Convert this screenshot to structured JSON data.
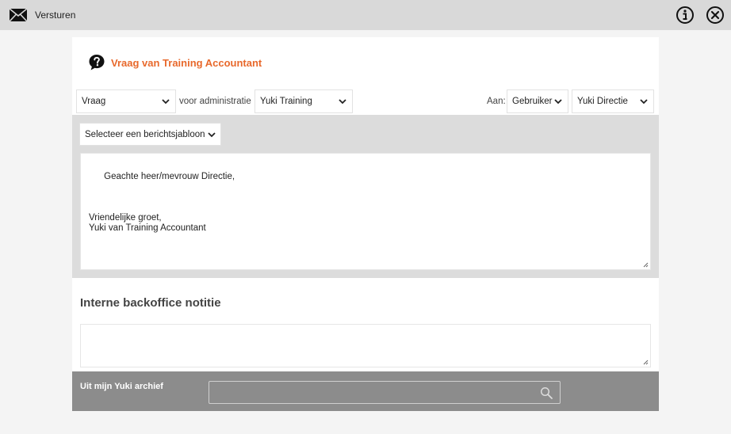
{
  "topbar": {
    "send_label": "Versturen",
    "icons": [
      "mail-icon",
      "info-icon",
      "close-icon"
    ]
  },
  "dialog": {
    "title": "Vraag van Training Accountant",
    "title_color": "#e8692c",
    "type_select": {
      "value": "Vraag"
    },
    "admin_label": "voor administratie",
    "admin_select": {
      "value": "Yuki Training"
    },
    "to_label": "Aan:",
    "recipient_type_select": {
      "value": "Gebruiker"
    },
    "recipient_select": {
      "value": "Yuki Directie"
    },
    "template_select": {
      "value": "Selecteer een berichtsjabloon"
    },
    "message_body": "Geachte heer/mevrouw Directie,\n\n\n\nVriendelijke groet,\nYuki van Training Accountant",
    "internal_note_heading": "Interne backoffice notitie",
    "internal_note_value": "",
    "archive": {
      "label": "Uit mijn Yuki archief",
      "search_value": ""
    }
  }
}
